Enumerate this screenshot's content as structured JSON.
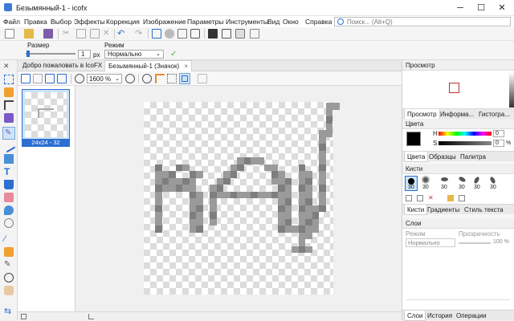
{
  "window": {
    "title": "Безымянный-1 - icofx",
    "minimize": "─",
    "maximize": "☐",
    "close": "✕"
  },
  "menu": [
    "Файл",
    "Правка",
    "Выбор",
    "Эффекты",
    "Коррекция",
    "Изображение",
    "Параметры",
    "Инструменты",
    "Вид",
    "Окно",
    "Справка"
  ],
  "search": {
    "placeholder": "Поиск... (Alt+Q)"
  },
  "toolbar2": {
    "size_label": "Размер",
    "size_value": "1",
    "size_unit": "px",
    "mode_label": "Режим",
    "mode_value": "Нормально"
  },
  "doc_tabs": [
    {
      "label": "Добро пожаловать в IcoFX",
      "close": "×"
    },
    {
      "label": "Безымянный-1 (Значок)",
      "close": "×"
    }
  ],
  "zoom": {
    "value": "1600 %"
  },
  "thumbnail": {
    "label": "24x24 - 32"
  },
  "right": {
    "preview": {
      "title": "Просмотр",
      "tabs": [
        "Просмотр",
        "Информа...",
        "Гистогра..."
      ]
    },
    "colors": {
      "title": "Цвета",
      "h_label": "H",
      "s_label": "S",
      "h_value": "0",
      "s_value": "0",
      "s_unit": "%",
      "tabs": [
        "Цвета",
        "Образцы",
        "Палитра"
      ]
    },
    "brushes": {
      "title": "Кисти",
      "sizes": [
        "30",
        "30",
        "30",
        "30",
        "30",
        "30"
      ],
      "tabs": [
        "Кисти",
        "Градиенты",
        "Стиль текста"
      ]
    },
    "layers": {
      "title": "Слои",
      "mode_label": "Режим",
      "opacity_label": "Прозрачность",
      "mode_value": "Нормально",
      "opacity_value": "100 %",
      "tabs": [
        "Слои",
        "История",
        "Операции"
      ]
    }
  },
  "colors_hex": {
    "accent": "#2d6fd1",
    "pixel_dark": "#9a9a9a",
    "pixel_darker": "#7e7e7e",
    "fg_color": "#000000"
  }
}
